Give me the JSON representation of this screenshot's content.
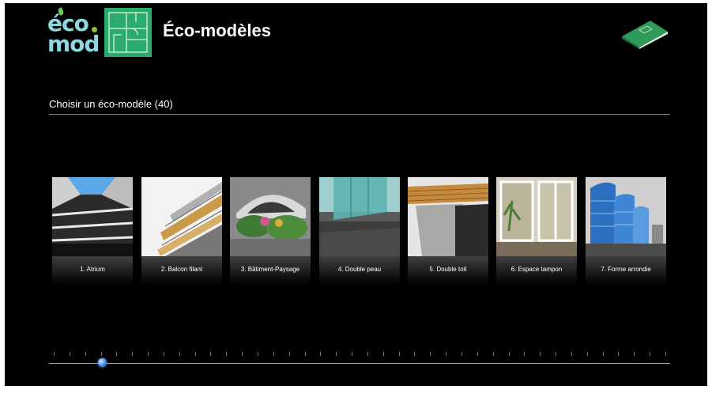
{
  "header": {
    "logo_line1": "éco",
    "logo_line2": "mod",
    "title": "Éco-modèles",
    "icons": [
      "eco-mod-logo",
      "floor-plan-icon",
      "book-icon"
    ]
  },
  "section": {
    "title": "Choisir un éco-modèle (40)"
  },
  "models": [
    {
      "label": "1. Atrium",
      "icon": "atrium-thumbnail"
    },
    {
      "label": "2. Balcon filant",
      "icon": "balcon-thumbnail"
    },
    {
      "label": "3. Bâtiment-Paysage",
      "icon": "batiment-paysage-thumbnail"
    },
    {
      "label": "4. Double peau",
      "icon": "double-peau-thumbnail"
    },
    {
      "label": "5. Double toit",
      "icon": "double-toit-thumbnail"
    },
    {
      "label": "6. Espace tampon",
      "icon": "espace-tampon-thumbnail"
    },
    {
      "label": "7. Forme arrondie",
      "icon": "forme-arrondie-thumbnail"
    }
  ],
  "slider": {
    "position": 0.085,
    "tick_count": 40
  },
  "colors": {
    "background": "#000000",
    "accent_green": "#2aaa6b",
    "logo_cyan": "#8fd7e0",
    "slider_knob": "#3d7ee6"
  }
}
